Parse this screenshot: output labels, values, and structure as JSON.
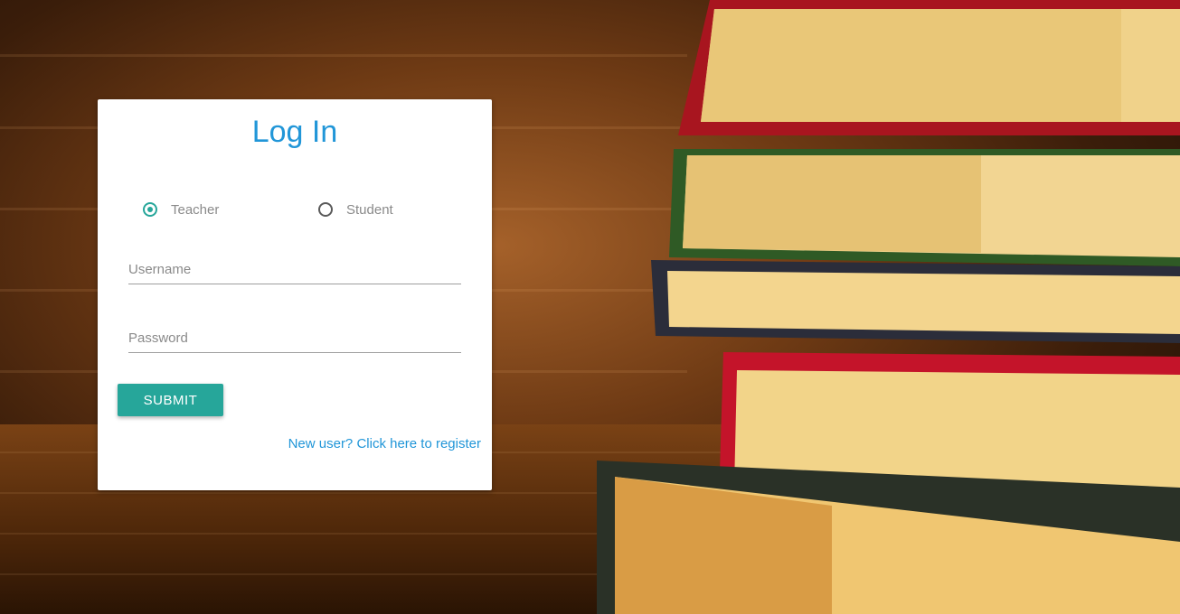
{
  "login": {
    "title": "Log In",
    "roles": [
      {
        "label": "Teacher",
        "selected": true
      },
      {
        "label": "Student",
        "selected": false
      }
    ],
    "username": {
      "placeholder": "Username",
      "value": ""
    },
    "password": {
      "placeholder": "Password",
      "value": ""
    },
    "submit_label": "SUBMIT",
    "register_link": "New user? Click here to register"
  },
  "colors": {
    "accent_teal": "#26a69a",
    "title_blue": "#2196d8",
    "link_blue": "#2196d8"
  },
  "background": {
    "icon": "stacked-books-photo"
  }
}
